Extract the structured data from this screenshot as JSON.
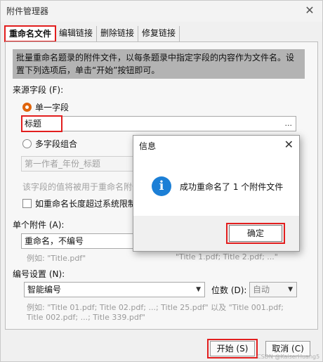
{
  "window": {
    "title": "附件管理器",
    "close": "✕"
  },
  "tabs": [
    {
      "label": "重命名文件"
    },
    {
      "label": "编辑链接"
    },
    {
      "label": "删除链接"
    },
    {
      "label": "修复链接"
    }
  ],
  "info_text": "批量重命名题录的附件文件，以每条题录中指定字段的内容作为文件名。设置下列选项后，单击“开始”按钮即可。",
  "source_field": {
    "label": "来源字段 (F):",
    "single": {
      "label": "单一字段",
      "value": "标题",
      "browse": "..."
    },
    "multi": {
      "label": "多字段组合",
      "value": "第一作者_年份_标题"
    },
    "note": "该字段的值将被用于重命名附件",
    "truncate_label": "如重命名长度超过系统限制"
  },
  "single_attachment": {
    "label": "单个附件 (A):",
    "value": "重命名，不编号",
    "example_left": "例如: \"Title.pdf\"",
    "example_right": "\"Title 1.pdf; Title 2.pdf; ...\""
  },
  "numbering": {
    "label": "编号设置 (N):",
    "value": "智能编号",
    "digits_label": "位数 (D):",
    "digits_value": "自动",
    "example": "例如: \"Title 01.pdf; Title 02.pdf; ...; Title 25.pdf\" 以及 \"Title 001.pdf; Title 002.pdf; ...; Title 339.pdf\""
  },
  "buttons": {
    "start": "开始 (S)",
    "cancel": "取消 (C)"
  },
  "modal": {
    "title": "信息",
    "close": "✕",
    "icon": "i",
    "message": "成功重命名了 1 个附件文件",
    "ok": "确定"
  },
  "watermark": "CSDN @KaiserHuang5",
  "colors": {
    "highlight": "#e21e1e",
    "radio_on": "#e0640c",
    "info_icon": "#1c7fd6"
  }
}
